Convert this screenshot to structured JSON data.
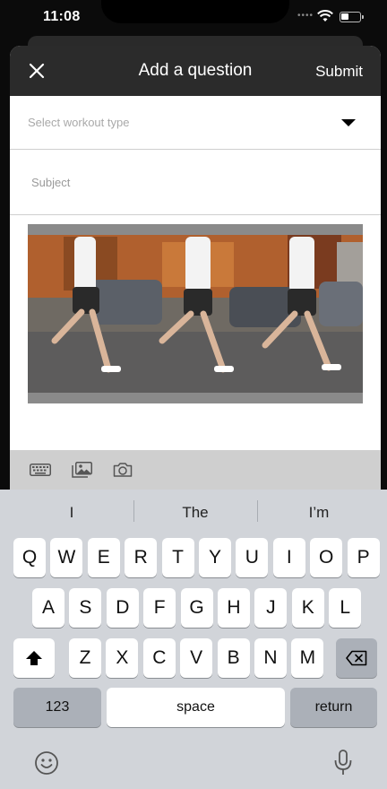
{
  "status": {
    "time": "11:08"
  },
  "header": {
    "title": "Add a question",
    "submit_label": "Submit"
  },
  "form": {
    "workout_placeholder": "Select workout type",
    "subject_placeholder": "Subject",
    "subject_value": ""
  },
  "toolbar": {
    "icons": [
      "keyboard-icon",
      "image-icon",
      "camera-icon"
    ]
  },
  "keyboard": {
    "suggestions": [
      "I",
      "The",
      "I’m"
    ],
    "row1": [
      "Q",
      "W",
      "E",
      "R",
      "T",
      "Y",
      "U",
      "I",
      "O",
      "P"
    ],
    "row2": [
      "A",
      "S",
      "D",
      "F",
      "G",
      "H",
      "J",
      "K",
      "L"
    ],
    "row3": [
      "Z",
      "X",
      "C",
      "V",
      "B",
      "N",
      "M"
    ],
    "numbers_label": "123",
    "space_label": "space",
    "return_label": "return"
  },
  "colors": {
    "nav_bg": "#2b2b2b",
    "keyboard_bg": "#d1d4d9",
    "toolbar_bg": "#cfcfcf"
  }
}
